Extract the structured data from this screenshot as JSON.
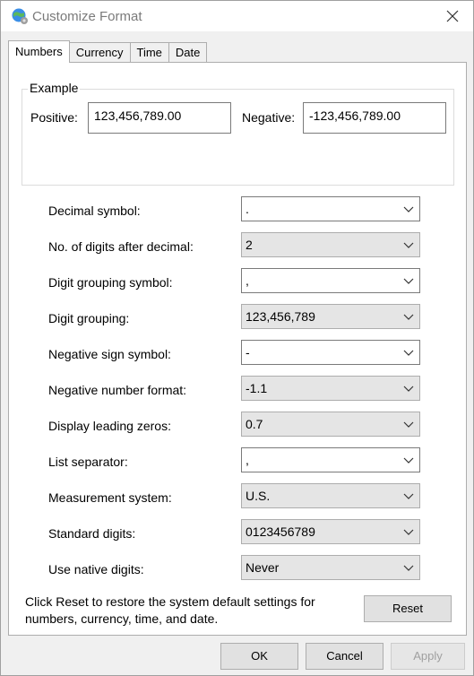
{
  "window": {
    "title": "Customize Format"
  },
  "tabs": [
    {
      "label": "Numbers",
      "active": true
    },
    {
      "label": "Currency",
      "active": false
    },
    {
      "label": "Time",
      "active": false
    },
    {
      "label": "Date",
      "active": false
    }
  ],
  "example": {
    "group_label": "Example",
    "positive_label": "Positive:",
    "positive_value": "123,456,789.00",
    "negative_label": "Negative:",
    "negative_value": "-123,456,789.00"
  },
  "settings": [
    {
      "label": "Decimal symbol:",
      "value": ".",
      "editable": true
    },
    {
      "label": "No. of digits after decimal:",
      "value": "2",
      "editable": false
    },
    {
      "label": "Digit grouping symbol:",
      "value": ",",
      "editable": true
    },
    {
      "label": "Digit grouping:",
      "value": "123,456,789",
      "editable": false
    },
    {
      "label": "Negative sign symbol:",
      "value": "-",
      "editable": true
    },
    {
      "label": "Negative number format:",
      "value": "-1.1",
      "editable": false
    },
    {
      "label": "Display leading zeros:",
      "value": "0.7",
      "editable": false
    },
    {
      "label": "List separator:",
      "value": ",",
      "editable": true
    },
    {
      "label": "Measurement system:",
      "value": "U.S.",
      "editable": false
    },
    {
      "label": "Standard digits:",
      "value": "0123456789",
      "editable": false
    },
    {
      "label": "Use native digits:",
      "value": "Never",
      "editable": false
    }
  ],
  "footer": {
    "text": "Click Reset to restore the system default settings for numbers, currency, time, and date.",
    "reset_label": "Reset"
  },
  "buttons": {
    "ok": "OK",
    "cancel": "Cancel",
    "apply": "Apply"
  },
  "icons": {
    "title": "globe-gear-icon",
    "close": "close-icon",
    "dropdown": "chevron-down-icon"
  }
}
